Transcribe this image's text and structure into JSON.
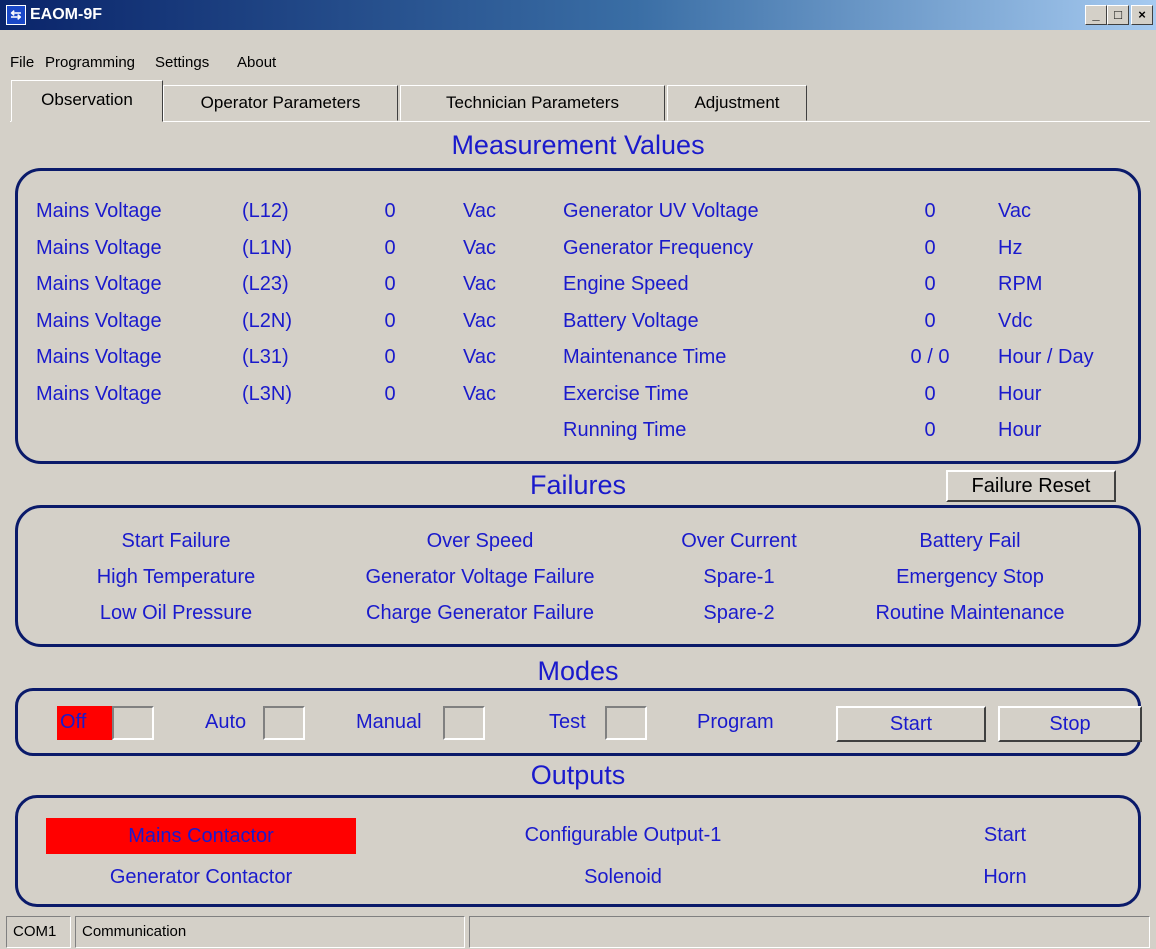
{
  "window": {
    "title": "EAOM-9F",
    "minimize": "_",
    "maximize": "□",
    "close": "×"
  },
  "menu": [
    "File",
    "Programming",
    "Settings",
    "About"
  ],
  "tabs": [
    "Observation",
    "Operator Parameters",
    "Technician Parameters",
    "Adjustment"
  ],
  "measurement": {
    "heading": "Measurement Values",
    "left": [
      {
        "label": "Mains Voltage",
        "phase": "(L12)",
        "value": "0",
        "unit": "Vac"
      },
      {
        "label": "Mains Voltage",
        "phase": "(L1N)",
        "value": "0",
        "unit": "Vac"
      },
      {
        "label": "Mains Voltage",
        "phase": "(L23)",
        "value": "0",
        "unit": "Vac"
      },
      {
        "label": "Mains Voltage",
        "phase": "(L2N)",
        "value": "0",
        "unit": "Vac"
      },
      {
        "label": "Mains Voltage",
        "phase": "(L31)",
        "value": "0",
        "unit": "Vac"
      },
      {
        "label": "Mains Voltage",
        "phase": "(L3N)",
        "value": "0",
        "unit": "Vac"
      }
    ],
    "right": [
      {
        "label": "Generator UV Voltage",
        "value": "0",
        "unit": "Vac"
      },
      {
        "label": "Generator Frequency",
        "value": "0",
        "unit": "Hz"
      },
      {
        "label": "Engine Speed",
        "value": "0",
        "unit": "RPM"
      },
      {
        "label": "Battery Voltage",
        "value": "0",
        "unit": "Vdc"
      },
      {
        "label": "Maintenance Time",
        "value": "0 / 0",
        "unit": "Hour / Day"
      },
      {
        "label": "Exercise Time",
        "value": "0",
        "unit": "Hour"
      },
      {
        "label": "Running Time",
        "value": "0",
        "unit": "Hour"
      }
    ]
  },
  "failures": {
    "heading": "Failures",
    "reset_label": "Failure Reset",
    "columns": [
      [
        "Start Failure",
        "High Temperature",
        "Low Oil Pressure"
      ],
      [
        "Over Speed",
        "Generator Voltage Failure",
        "Charge Generator Failure"
      ],
      [
        "Over Current",
        "Spare-1",
        "Spare-2"
      ],
      [
        "Battery Fail",
        "Emergency Stop",
        "Routine Maintenance"
      ]
    ]
  },
  "modes": {
    "heading": "Modes",
    "off": "Off",
    "auto": "Auto",
    "manual": "Manual",
    "test": "Test",
    "program": "Program",
    "start": "Start",
    "stop": "Stop",
    "active_color": "#ff0000"
  },
  "outputs": {
    "heading": "Outputs",
    "mains_contactor": "Mains Contactor",
    "generator_contactor": "Generator Contactor",
    "configurable_output": "Configurable Output-1",
    "solenoid": "Solenoid",
    "start": "Start",
    "horn": "Horn",
    "active_color": "#ff0000"
  },
  "status": {
    "port": "COM1",
    "communication": "Communication"
  }
}
